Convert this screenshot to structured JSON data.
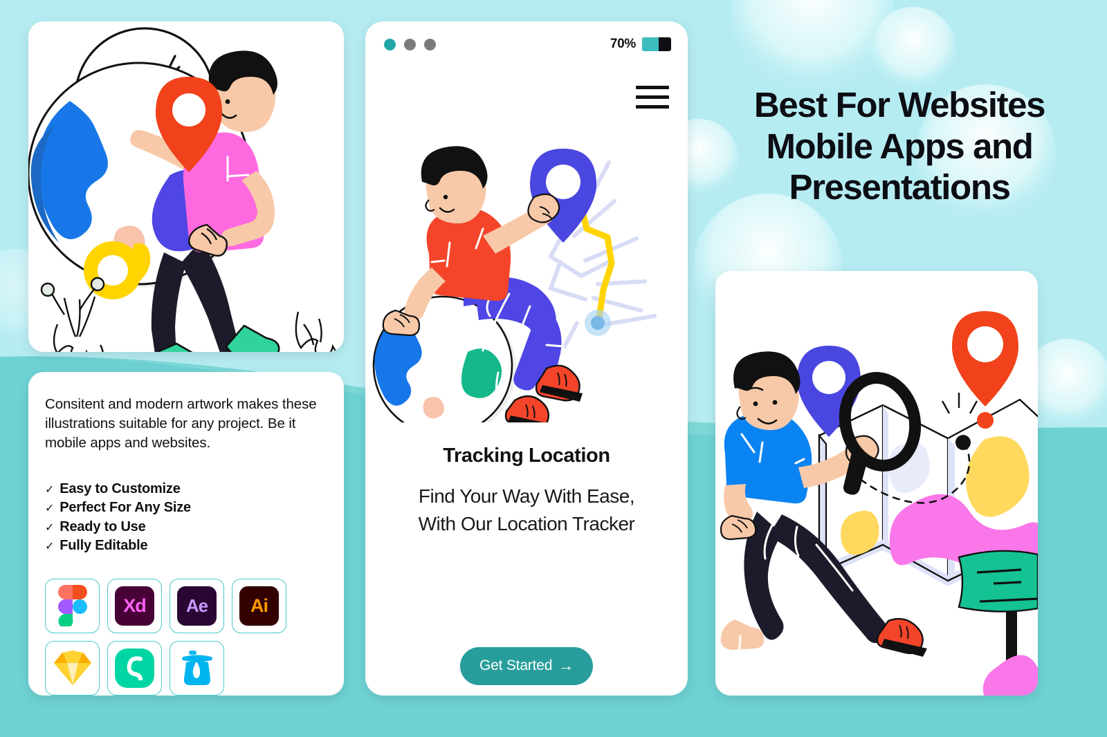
{
  "background": {
    "top_color": "#b5ecf2",
    "band_color": "#6ed2d3",
    "bubble_color": "#ffffff"
  },
  "headline": {
    "lines": [
      "Best For Websites",
      "Mobile Apps and",
      "Presentations"
    ],
    "color": "#0d0d14"
  },
  "features_card": {
    "paragraph": "Consitent and modern artwork makes these illustrations suitable for any project. Be it mobile apps and websites.",
    "check_glyph": "✓",
    "list": [
      "Easy to Customize",
      "Perfect For Any Size",
      "Ready to Use",
      "Fully Editable"
    ],
    "tools": [
      {
        "name": "figma",
        "label": "",
        "bg": "#ffffff",
        "fg": "#ffffff"
      },
      {
        "name": "adobe-xd",
        "label": "Xd",
        "bg": "#470137",
        "fg": "#ff61f6"
      },
      {
        "name": "after-effects",
        "label": "Ae",
        "bg": "#2a0634",
        "fg": "#c39bff"
      },
      {
        "name": "illustrator",
        "label": "Ai",
        "bg": "#330000",
        "fg": "#ff9a00"
      },
      {
        "name": "sketch",
        "label": "",
        "bg": "#ffffff",
        "fg": "#fdb300"
      },
      {
        "name": "invision-studio",
        "label": "",
        "bg": "#00d6a3",
        "fg": "#ffffff"
      },
      {
        "name": "lottiefiles",
        "label": "",
        "bg": "#ffffff",
        "fg": "#00b4f0"
      }
    ]
  },
  "phone": {
    "status": {
      "battery_percent_label": "70%",
      "battery_level": 70,
      "battery_color": "#3dbdbd",
      "dots": [
        "#22a7a7",
        "#7b7b7b",
        "#7b7b7b"
      ]
    },
    "menu_icon": "hamburger-icon",
    "title": "Tracking Location",
    "subtitle_lines": [
      "Find Your Way With Ease,",
      "With Our Location Tracker"
    ],
    "cta": {
      "label": "Get Started",
      "arrow": "→",
      "color": "#279e9b"
    }
  },
  "illustrations": {
    "globe_card": {
      "name": "person-holding-globe-with-magnifier",
      "colors": {
        "pin": "#f1421b",
        "shirt": "#ff69e0",
        "pants": "#1b1b2b",
        "shoes": "#2fd39b",
        "globe_blue": "#1877e8",
        "globe_darkblue": "#1b69c4",
        "globe_purple": "#4f46e5",
        "globe_green": "#14b88a",
        "globe_skin": "#f8c3aa",
        "magnifier_yellow": "#ffd400",
        "skin": "#f8c9a8"
      }
    },
    "phone_art": {
      "name": "person-sitting-on-globe-pointing-at-pin",
      "colors": {
        "pin": "#4a46e0",
        "shirt": "#f4452a",
        "pants": "#4f46e5",
        "shoes": "#f4452a",
        "route": "#ffd400",
        "map_lines": "#d8dcf5"
      }
    },
    "map_card": {
      "name": "person-running-with-magnifier-on-map",
      "colors": {
        "pin_red": "#f1421b",
        "pin_blue": "#4a46e0",
        "shirt": "#0b84f3",
        "pants": "#1b1b2b",
        "shoes": "#f4452a",
        "map_fold": "#dde2f7",
        "blob_yellow": "#ffd85e",
        "blob_pink": "#f977e8",
        "sign_green": "#14c293"
      }
    }
  }
}
